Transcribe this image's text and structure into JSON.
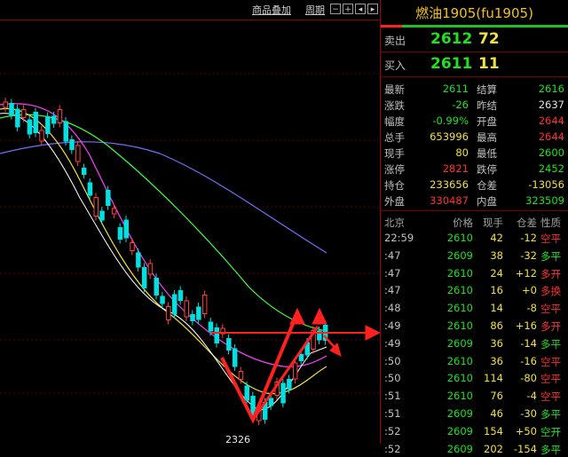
{
  "toolbar": {
    "overlay_label": "商品叠加",
    "period_label": "周期",
    "icons": [
      "minus-icon",
      "plus-icon",
      "left-icon",
      "right-icon"
    ]
  },
  "chart": {
    "low_label": "2326",
    "colors": {
      "up": "#00e0e0",
      "down": "#00e0e0",
      "ma5": "#ffffff",
      "ma10": "#f0e040",
      "ma20": "#ff40ff",
      "ma40": "#40ff40",
      "ma60": "#7070ff",
      "annot": "#ff2020"
    }
  },
  "panel": {
    "title": "燃油1905(fu1905)",
    "sell_label": "卖出",
    "sell_price": "2612",
    "sell_vol": "72",
    "buy_label": "买入",
    "buy_price": "2611",
    "buy_vol": "11",
    "quotes": [
      {
        "l1": "最新",
        "v1": "2611",
        "c1": "g",
        "l2": "结算",
        "v2": "2616",
        "c2": "g"
      },
      {
        "l1": "涨跌",
        "v1": "-26",
        "c1": "g",
        "l2": "昨结",
        "v2": "2637",
        "c2": "w"
      },
      {
        "l1": "幅度",
        "v1": "-0.99%",
        "c1": "g",
        "l2": "开盘",
        "v2": "2644",
        "c2": "r"
      },
      {
        "l1": "总手",
        "v1": "653996",
        "c1": "y",
        "l2": "最高",
        "v2": "2644",
        "c2": "r"
      },
      {
        "l1": "现手",
        "v1": "80",
        "c1": "y",
        "l2": "最低",
        "v2": "2600",
        "c2": "g"
      },
      {
        "l1": "涨停",
        "v1": "2821",
        "c1": "r",
        "l2": "跌停",
        "v2": "2452",
        "c2": "g"
      },
      {
        "l1": "持仓",
        "v1": "233656",
        "c1": "y",
        "l2": "仓差",
        "v2": "-13056",
        "c2": "y"
      },
      {
        "l1": "外盘",
        "v1": "330487",
        "c1": "r",
        "l2": "内盘",
        "v2": "323509",
        "c2": "g"
      }
    ],
    "tick_header": {
      "time": "北京",
      "price": "价格",
      "hand": "现手",
      "oi": "仓差",
      "nature": "性质"
    },
    "ticks": [
      {
        "time": "22:59",
        "price": "2610",
        "hand": "42",
        "oi": "-12",
        "oic": "y",
        "nature": "空平",
        "nc": "r"
      },
      {
        "time": ":47",
        "price": "2609",
        "hand": "38",
        "oi": "-32",
        "oic": "y",
        "nature": "多平",
        "nc": "g"
      },
      {
        "time": ":47",
        "price": "2610",
        "hand": "24",
        "oi": "+12",
        "oic": "y",
        "nature": "多开",
        "nc": "r"
      },
      {
        "time": ":47",
        "price": "2610",
        "hand": "16",
        "oi": "+0",
        "oic": "y",
        "nature": "多换",
        "nc": "r"
      },
      {
        "time": ":48",
        "price": "2610",
        "hand": "14",
        "oi": "-8",
        "oic": "y",
        "nature": "空平",
        "nc": "r"
      },
      {
        "time": ":49",
        "price": "2610",
        "hand": "86",
        "oi": "+16",
        "oic": "y",
        "nature": "多开",
        "nc": "r"
      },
      {
        "time": ":49",
        "price": "2609",
        "hand": "36",
        "oi": "-14",
        "oic": "y",
        "nature": "多平",
        "nc": "g"
      },
      {
        "time": ":50",
        "price": "2610",
        "hand": "36",
        "oi": "-16",
        "oic": "y",
        "nature": "空平",
        "nc": "r"
      },
      {
        "time": ":50",
        "price": "2610",
        "hand": "114",
        "oi": "-80",
        "oic": "y",
        "nature": "空平",
        "nc": "r"
      },
      {
        "time": ":51",
        "price": "2610",
        "hand": "76",
        "oi": "-4",
        "oic": "y",
        "nature": "空平",
        "nc": "r"
      },
      {
        "time": ":51",
        "price": "2609",
        "hand": "46",
        "oi": "-30",
        "oic": "y",
        "nature": "多平",
        "nc": "g"
      },
      {
        "time": ":52",
        "price": "2609",
        "hand": "154",
        "oi": "+50",
        "oic": "y",
        "nature": "空开",
        "nc": "g"
      },
      {
        "time": ":52",
        "price": "2609",
        "hand": "202",
        "oi": "-154",
        "oic": "y",
        "nature": "多平",
        "nc": "g"
      }
    ]
  }
}
